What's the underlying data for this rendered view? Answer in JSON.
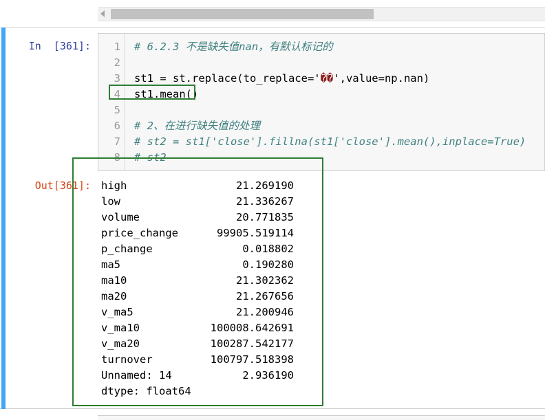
{
  "input_prompt": "In  [361]:",
  "output_prompt": "Out[361]:",
  "code_lines": [
    {
      "n": "1",
      "type": "comment",
      "text": "# 6.2.3 不是缺失值nan，有默认标记的"
    },
    {
      "n": "2",
      "type": "blank",
      "text": ""
    },
    {
      "n": "3",
      "type": "replace",
      "a": "st1 = st.replace(to_replace='",
      "glyphs": "��",
      "b": "',value=np.nan)"
    },
    {
      "n": "4",
      "type": "code",
      "text": "st1.mean()"
    },
    {
      "n": "5",
      "type": "blank",
      "text": ""
    },
    {
      "n": "6",
      "type": "comment",
      "text": "# 2、在进行缺失值的处理"
    },
    {
      "n": "7",
      "type": "comment",
      "text": "# st2 = st1['close'].fillna(st1['close'].mean(),inplace=True)"
    },
    {
      "n": "8",
      "type": "comment",
      "text": "# st2"
    }
  ],
  "output": [
    {
      "key": "high",
      "value": "21.269190"
    },
    {
      "key": "low",
      "value": "21.336267"
    },
    {
      "key": "volume",
      "value": "20.771835"
    },
    {
      "key": "price_change",
      "value": "99905.519114"
    },
    {
      "key": "p_change",
      "value": "0.018802"
    },
    {
      "key": "ma5",
      "value": "0.190280"
    },
    {
      "key": "ma10",
      "value": "21.302362"
    },
    {
      "key": "ma20",
      "value": "21.267656"
    },
    {
      "key": "v_ma5",
      "value": "21.200946"
    },
    {
      "key": "v_ma10",
      "value": "100008.642691"
    },
    {
      "key": "v_ma20",
      "value": "100287.542177"
    },
    {
      "key": "turnover",
      "value": "100797.518398"
    },
    {
      "key": "Unnamed: 14",
      "value": "2.936190"
    }
  ],
  "dtype": "dtype: float64",
  "colors": {
    "cell_selected_bar": "#42a5f5",
    "in_prompt": "#303f9f",
    "out_prompt": "#d84315",
    "comment": "#408080",
    "string": "#ba2121",
    "highlight_box": "#2e7d32"
  }
}
